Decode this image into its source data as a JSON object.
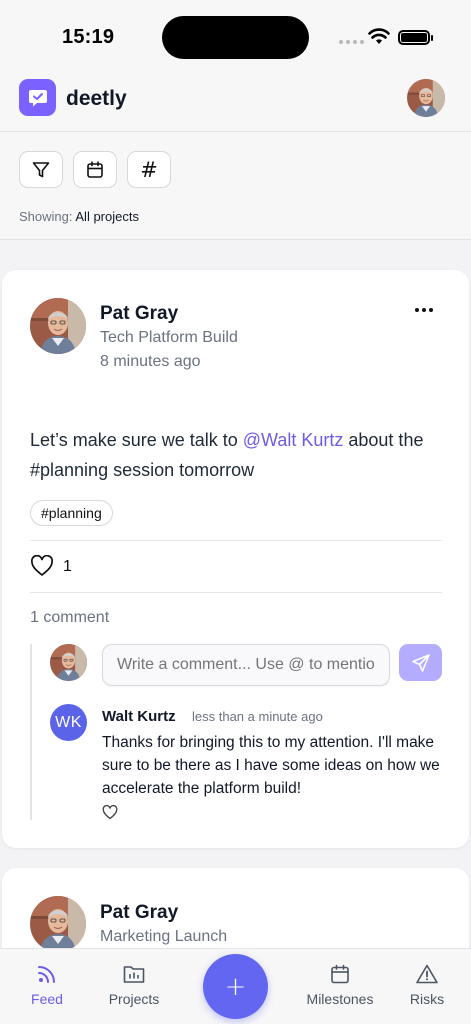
{
  "status_bar": {
    "time": "15:19"
  },
  "app": {
    "name": "deetly"
  },
  "filters": {
    "showing_label": "Showing:",
    "showing_value": "All projects"
  },
  "posts": [
    {
      "author": "Pat Gray",
      "project": "Tech Platform Build",
      "time": "8 minutes ago",
      "body_before": "Let’s make sure we talk to ",
      "mention": "@Walt Kurtz",
      "body_after": "  about the #planning session tomorrow",
      "tag": "#planning",
      "likes": "1",
      "comment_count": "1 comment",
      "comment_placeholder": "Write a comment... Use @ to mention",
      "comments": [
        {
          "initials": "WK",
          "author": "Walt Kurtz",
          "time": "less than a minute ago",
          "text": "Thanks for bringing this to my attention. I'll make sure to be there as I have some ideas on how we accelerate the platform build!"
        }
      ]
    },
    {
      "author": "Pat Gray",
      "project": "Marketing Launch"
    }
  ],
  "nav": {
    "feed": "Feed",
    "projects": "Projects",
    "add": "+",
    "milestones": "Milestones",
    "risks": "Risks"
  },
  "colors": {
    "accent": "#6d5ce8",
    "fab": "#6366f1",
    "logo": "#7b61ff",
    "send_disabled": "#b3acff",
    "wk_avatar": "#5b64e8"
  }
}
